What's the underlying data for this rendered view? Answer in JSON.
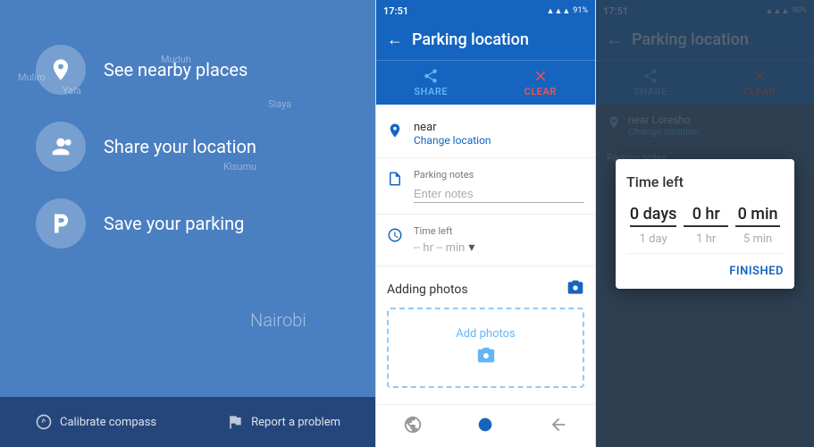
{
  "panel1": {
    "menu_items": [
      {
        "id": "nearby",
        "label": "See nearby places",
        "icon": "location"
      },
      {
        "id": "share",
        "label": "Share your location",
        "icon": "person-share"
      },
      {
        "id": "parking",
        "label": "Save your parking",
        "icon": "parking"
      }
    ],
    "map_city": "Nairobi",
    "map_labels": [
      "Muliro",
      "Yala",
      "Muduh",
      "Siaya",
      "Kisumu"
    ],
    "bottom_bar": [
      {
        "id": "calibrate",
        "label": "Calibrate compass",
        "icon": "compass"
      },
      {
        "id": "report",
        "label": "Report a problem",
        "icon": "flag"
      }
    ]
  },
  "panel2": {
    "status_time": "17:51",
    "status_battery": "91%",
    "title": "Parking location",
    "actions": [
      {
        "id": "share",
        "label": "SHARE",
        "icon": "share"
      },
      {
        "id": "clear",
        "label": "CLEAR",
        "icon": "close"
      }
    ],
    "location": {
      "text": "near",
      "change_label": "Change location"
    },
    "notes": {
      "label": "Parking notes",
      "placeholder": "Enter notes"
    },
    "time": {
      "label": "Time left",
      "value": "-- hr -- min",
      "dropdown": "▾"
    },
    "photos": {
      "title": "Adding photos",
      "add_label": "Add photos"
    },
    "nav_items": [
      "globe",
      "circle-dot",
      "arrow-back"
    ]
  },
  "panel3": {
    "status_time": "17:51",
    "status_battery": "90%",
    "title": "Parking location",
    "actions": [
      {
        "id": "share",
        "label": "SHARE",
        "icon": "share"
      },
      {
        "id": "clear",
        "label": "CLEAR",
        "icon": "close"
      }
    ],
    "location": {
      "text": "near Loresho",
      "change_label": "Change location"
    },
    "dialog": {
      "title": "Time left",
      "columns": [
        {
          "selected": "0 days",
          "below": "1 day"
        },
        {
          "selected": "0 hr",
          "below": "1 hr"
        },
        {
          "selected": "0 min",
          "below": "5 min"
        }
      ],
      "finished_label": "FINISHED"
    }
  }
}
